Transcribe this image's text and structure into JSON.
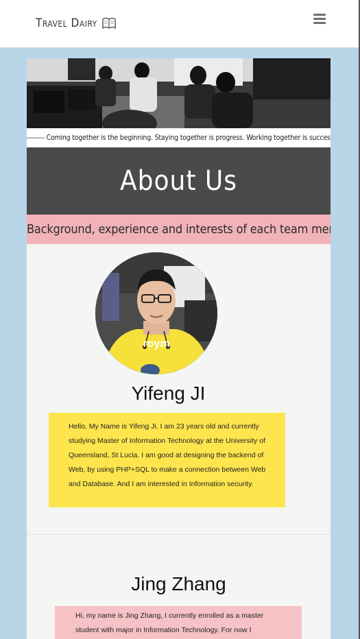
{
  "header": {
    "brand": "Travel Dairy",
    "logo_icon": "book-icon",
    "menu_icon": "hamburger-menu-icon"
  },
  "hero": {
    "image_subject": "team members sitting in a computer lab",
    "quote": "-------- Coming together is the beginning. Staying together is progress. Working together is success."
  },
  "about": {
    "title": "About Us",
    "subtitle": "Background, experience and interests of each team member"
  },
  "members": [
    {
      "name": "Yifeng JI",
      "bio": "Hello, My Name is Yifeng Ji. I am 23 years old and currently studying Master of Information Technology at the University of Queensland, St Lucia. I am good at designing the backend of Web, by using PHP+SQL to make a connection between Web and Database. And I am interested in Information security.",
      "bio_color": "#fde54e"
    },
    {
      "name": "Jing Zhang",
      "bio": "Hi, my name is Jing Zhang, I currently enrolled as a master student with major in Information Technology. For now I",
      "bio_color": "#f6c2c6"
    }
  ],
  "colors": {
    "page_bg": "#b9d5e8",
    "about_bg": "#4a4a4a",
    "subtitle_bg": "#f1b3b8"
  }
}
